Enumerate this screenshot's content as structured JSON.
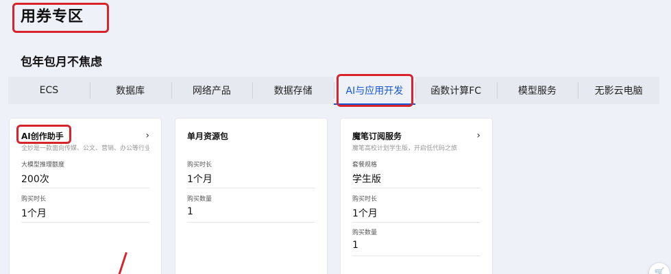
{
  "page": {
    "title": "用券专区",
    "section_title": "包年包月不焦虑"
  },
  "tabs": [
    {
      "label": "ECS"
    },
    {
      "label": "数据库"
    },
    {
      "label": "网络产品"
    },
    {
      "label": "数据存储"
    },
    {
      "label": "AI与应用开发",
      "active": true
    },
    {
      "label": "函数计算FC"
    },
    {
      "label": "模型服务"
    },
    {
      "label": "无影云电脑"
    }
  ],
  "cards": [
    {
      "title": "AI创作助手",
      "desc": "全妙是一款面向传媒、公文、营销、办公等行业...",
      "fields": [
        {
          "label": "大模型推理额度",
          "value": "200次"
        },
        {
          "label": "购买时长",
          "value": "1个月"
        }
      ]
    },
    {
      "title": "单月资源包",
      "fields": [
        {
          "label": "购买时长",
          "value": "1个月"
        },
        {
          "label": "购买数量",
          "value": "1"
        }
      ]
    },
    {
      "title": "魔笔订阅服务",
      "desc": "魔笔高校计划学生版，开启低代码之旅",
      "fields": [
        {
          "label": "套餐规格",
          "value": "学生版"
        },
        {
          "label": "购买时长",
          "value": "1个月"
        },
        {
          "label": "购买数量",
          "value": "1"
        }
      ]
    }
  ],
  "icons": {
    "chevron": "›",
    "cart": "🛒"
  },
  "colors": {
    "accent": "#1556d6",
    "annotation": "#d8232a",
    "background": "#eef1f8"
  }
}
